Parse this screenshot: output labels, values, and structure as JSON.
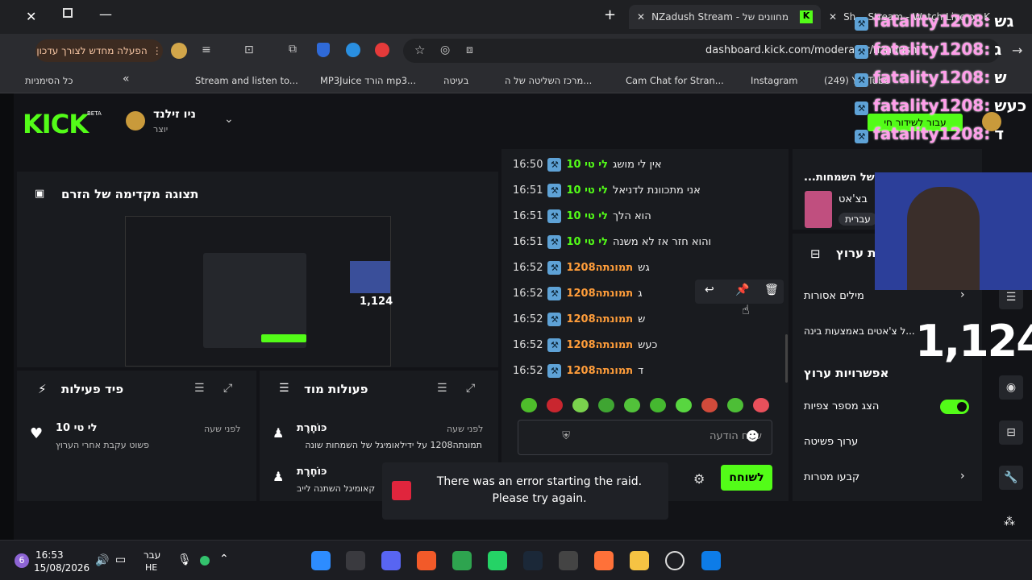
{
  "browser": {
    "tabs": [
      {
        "label": "NZadush Stream - מחוונים של"
      },
      {
        "label": "Sh... Stream - Watch Live on K"
      }
    ],
    "update_button": "הפעלה מחדש לצורך עדכון",
    "url": "dashboard.kick.com/moderator/nzadush",
    "bookmarks": [
      "Stream and listen to...",
      "MP3Juice הורד mp3...",
      "בעיטה",
      "מרכז השליטה של ה...",
      "Cam Chat for Stran...",
      "Instagram",
      "(249) YouTube",
      "כל הסימניות"
    ]
  },
  "kick": {
    "logo": "KICK",
    "beta": "BETA",
    "channel_name": "ניו זילנד",
    "channel_role": "יוצר",
    "go_live": "עבור לשידור חי",
    "preview_title": "תצוגה מקדימה של הזרם",
    "preview_viewers": "1,124",
    "activity_feed_title": "פיד פעילות",
    "activity_item": {
      "name": "לי טי 10",
      "time": "לפני שעה",
      "text": "פשוט עקבת אחרי הערוץ"
    },
    "mod_actions_title": "פעולות מוד",
    "mod_actions": [
      {
        "name": "כּוֹחֶרֶת",
        "time": "לפני שעה",
        "text": "תמונתה1208 על ידילאומיגל של השמחות שונה"
      },
      {
        "name": "כּוֹחֶרֶת",
        "time": "",
        "text": "קאומיגל השתנה לייב"
      }
    ],
    "chat": [
      {
        "time": "16:50",
        "user": "לי טי 10",
        "msg": "אין לי מושג",
        "color": "#53fc18"
      },
      {
        "time": "16:51",
        "user": "לי טי 10",
        "msg": "אני מתכוונת לדניאל",
        "color": "#53fc18"
      },
      {
        "time": "16:51",
        "user": "לי טי 10",
        "msg": "הוא הלך",
        "color": "#53fc18"
      },
      {
        "time": "16:51",
        "user": "לי טי 10",
        "msg": "והוא חזר אז לא משנה",
        "color": "#53fc18"
      },
      {
        "time": "16:52",
        "user": "תמונתה1208",
        "msg": "גש",
        "color": "#ff9d3a"
      },
      {
        "time": "16:52",
        "user": "תמונתה1208",
        "msg": "ג",
        "color": "#ff9d3a"
      },
      {
        "time": "16:52",
        "user": "תמונתה1208",
        "msg": "ש",
        "color": "#ff9d3a"
      },
      {
        "time": "16:52",
        "user": "תמונתה1208",
        "msg": "כעש",
        "color": "#ff9d3a"
      },
      {
        "time": "16:52",
        "user": "תמונתה1208",
        "msg": "ד",
        "color": "#ff9d3a"
      }
    ],
    "chat_placeholder": "שלח הודעה",
    "send_button": "לשוחח",
    "toast": "There was an error starting the raid. Please try again.",
    "right": {
      "category_title": "...ל של השמחות",
      "category_sub": "בצ'אט",
      "language": "עברית",
      "edit_title": "ת ערוץ",
      "banned_words": "מילים אסורות",
      "ai_chat": "...ל צ'אטים באמצעות בינה",
      "channel_options": "אפשרויות ערוץ",
      "show_viewers": "הצג מספר צפיות",
      "show_viewers_enabled": true,
      "edit_stream": "ערוך פשיטה",
      "set_goals": "קבעו מטרות"
    }
  },
  "overlay": {
    "lines": [
      {
        "name": "fatality1208:",
        "msg": "גש"
      },
      {
        "name": "fatality1208:",
        "msg": "ג"
      },
      {
        "name": "fatality1208:",
        "msg": "ש"
      },
      {
        "name": "fatality1208:",
        "msg": "כעש"
      },
      {
        "name": "fatality1208:",
        "msg": "ד"
      }
    ],
    "viewers_big": "1,124"
  },
  "taskbar": {
    "time": "16:53",
    "date": "15/08/2026",
    "lang1": "עבר",
    "lang2": "HE",
    "notif": "6"
  },
  "colors": {
    "kick_green": "#53fc18",
    "badge_blue": "#5ea2d6",
    "toast_red": "#e0253d"
  }
}
